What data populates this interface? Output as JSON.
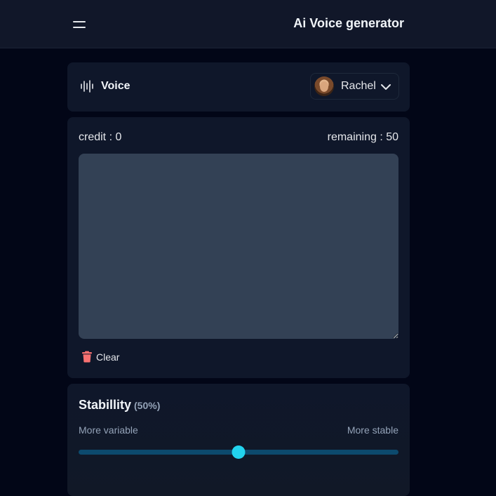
{
  "header": {
    "title": "Ai Voice generator",
    "menu_icon": "hamburger-menu-icon"
  },
  "voice": {
    "label": "Voice",
    "icon": "waveform-icon",
    "selected_name": "Rachel",
    "dropdown_icon": "chevron-down-icon"
  },
  "text": {
    "credit": "credit : 0",
    "remaining": "remaining : 50",
    "value": "",
    "placeholder": "",
    "clear_label": "Clear",
    "clear_icon": "trash-icon",
    "clear_icon_color": "#f87171"
  },
  "stability": {
    "title": "Stabillity",
    "percent_label": "(50%)",
    "value_fraction": 0.5,
    "left_label": "More variable",
    "right_label": "More stable",
    "track_color": "#0c4a6e",
    "thumb_color": "#22d3ee"
  }
}
